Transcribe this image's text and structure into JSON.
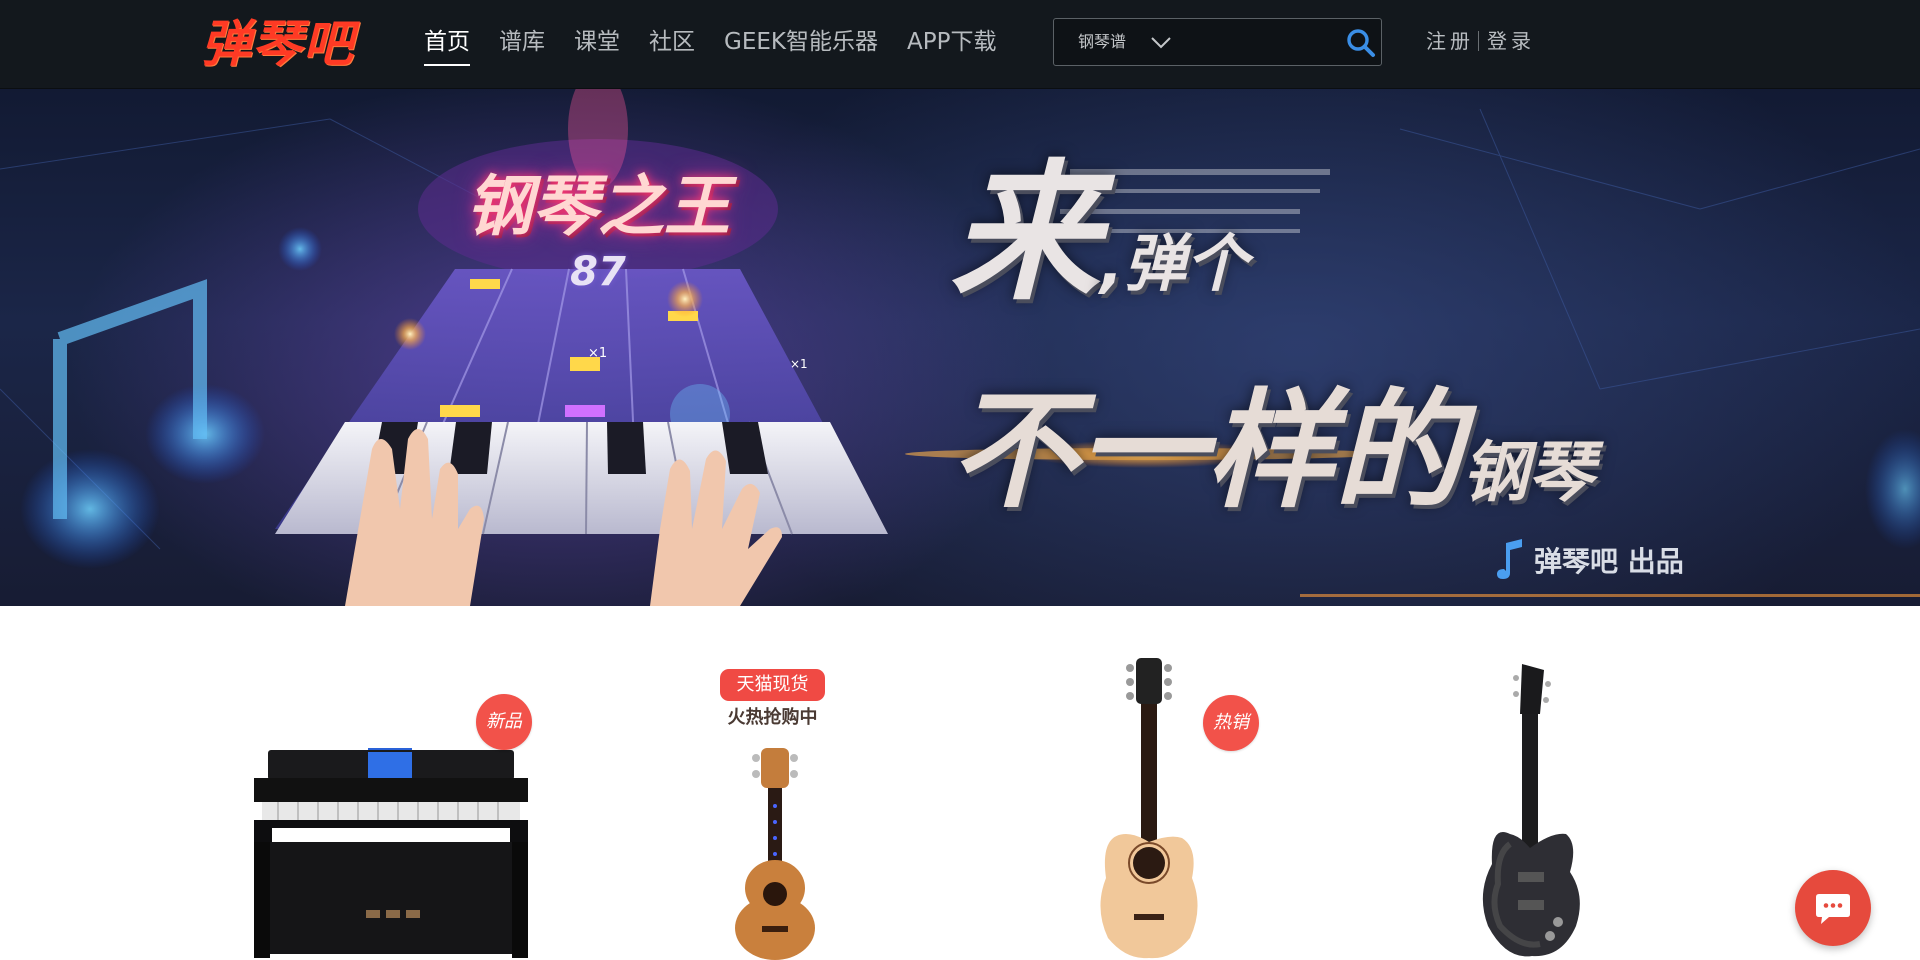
{
  "header": {
    "logo_text": "弹琴吧",
    "nav": [
      {
        "label": "首页",
        "active": true
      },
      {
        "label": "谱库",
        "active": false
      },
      {
        "label": "课堂",
        "active": false
      },
      {
        "label": "社区",
        "active": false
      },
      {
        "label": "GEEK智能乐器",
        "active": false
      },
      {
        "label": "APP下载",
        "active": false
      }
    ],
    "search": {
      "category": "钢琴谱",
      "placeholder": "",
      "icon": "search-icon"
    },
    "register_label": "注册",
    "login_label": "登录"
  },
  "banner": {
    "game_title": "钢琴之王",
    "score": "87",
    "combo_left": "×1",
    "combo_right": "×1",
    "headline_big": "来",
    "headline_small": ",弹个",
    "sub_big": "不一样的",
    "sub_small": "钢琴",
    "credit": "弹琴吧 出品"
  },
  "products": {
    "badge_new": "新品",
    "promo_tag": "天猫现货",
    "promo_sub": "火热抢购中",
    "badge_hot": "热销",
    "items": [
      "digital-piano",
      "ukulele",
      "acoustic-guitar",
      "electric-guitar"
    ]
  },
  "colors": {
    "nav_bg": "#13181d",
    "accent": "#ff3a24",
    "badge": "#f2524a",
    "chat": "#e64a3d"
  },
  "chat": {
    "icon": "chat-bubble-icon"
  }
}
